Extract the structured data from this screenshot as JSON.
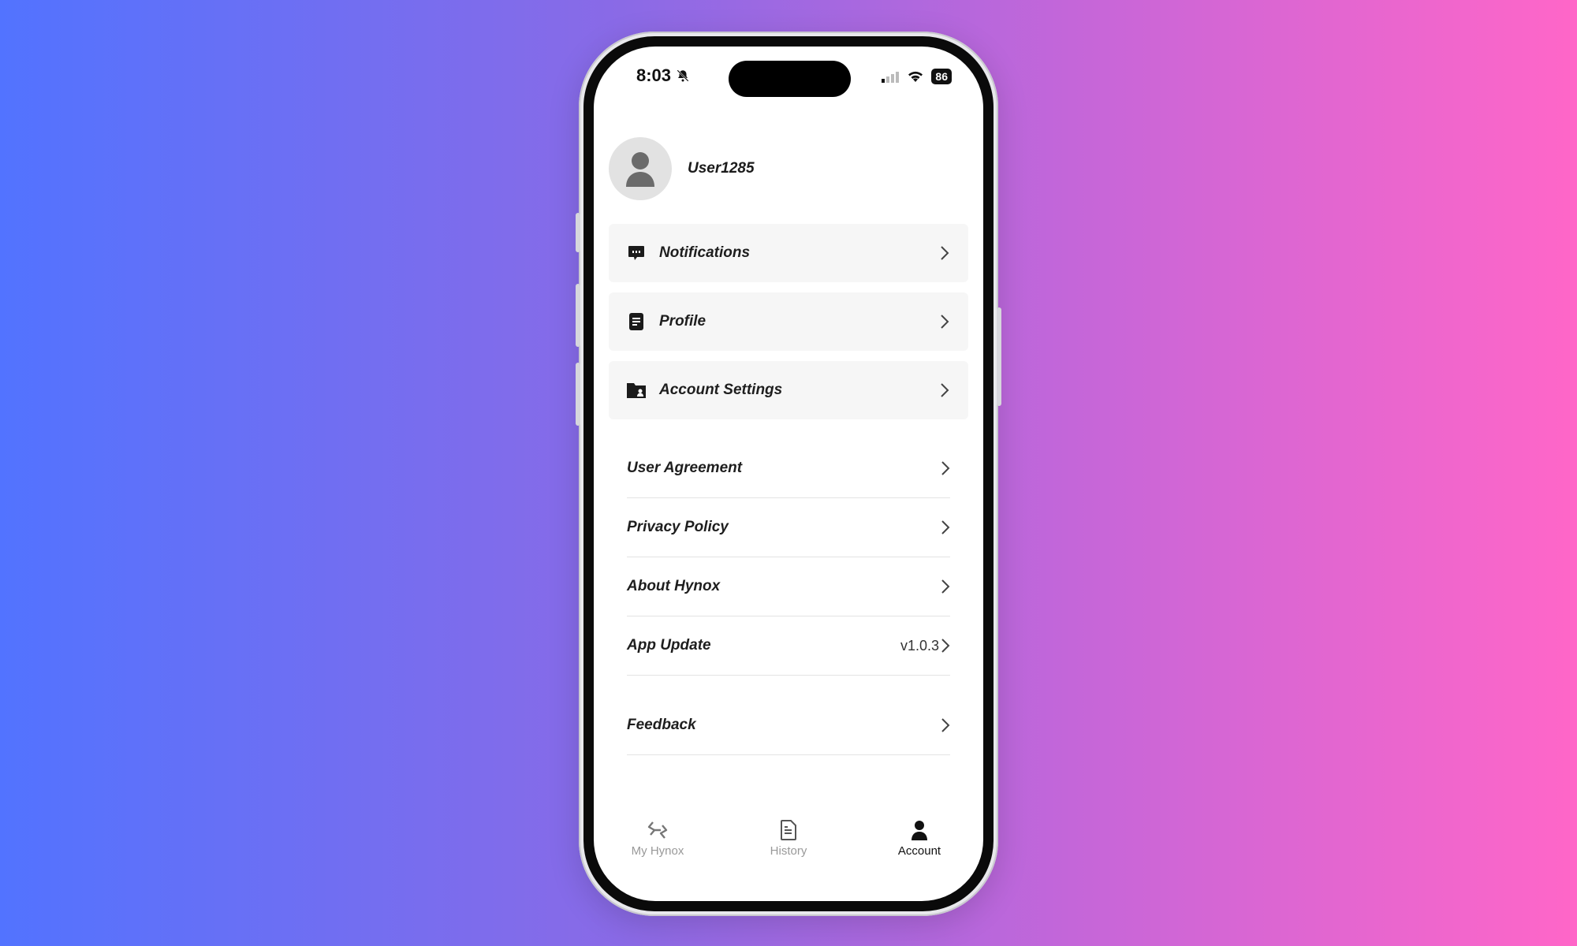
{
  "status_bar": {
    "time": "8:03",
    "battery": "86",
    "icons": [
      "bell-slash-icon",
      "signal-icon",
      "wifi-icon",
      "battery-icon"
    ]
  },
  "user": {
    "name": "User1285",
    "avatar_icon": "person-icon"
  },
  "cards": [
    {
      "label": "Notifications",
      "icon": "chat-bubble-icon"
    },
    {
      "label": "Profile",
      "icon": "document-icon"
    },
    {
      "label": "Account Settings",
      "icon": "folder-user-icon"
    }
  ],
  "list": [
    {
      "label": "User Agreement"
    },
    {
      "label": "Privacy Policy"
    },
    {
      "label": "About Hynox"
    },
    {
      "label": "App Update",
      "value": "v1.0.3"
    }
  ],
  "feedback": {
    "label": "Feedback"
  },
  "tabs": [
    {
      "label": "My Hynox",
      "icon": "hynox-logo-icon",
      "active": false
    },
    {
      "label": "History",
      "icon": "history-document-icon",
      "active": false
    },
    {
      "label": "Account",
      "icon": "person-icon",
      "active": true
    }
  ],
  "colors": {
    "background_gradient_start": "#5273ff",
    "background_gradient_end": "#ff66c8",
    "card_bg": "#f6f6f6",
    "active_tab": "#111111",
    "inactive_tab": "#999999"
  }
}
